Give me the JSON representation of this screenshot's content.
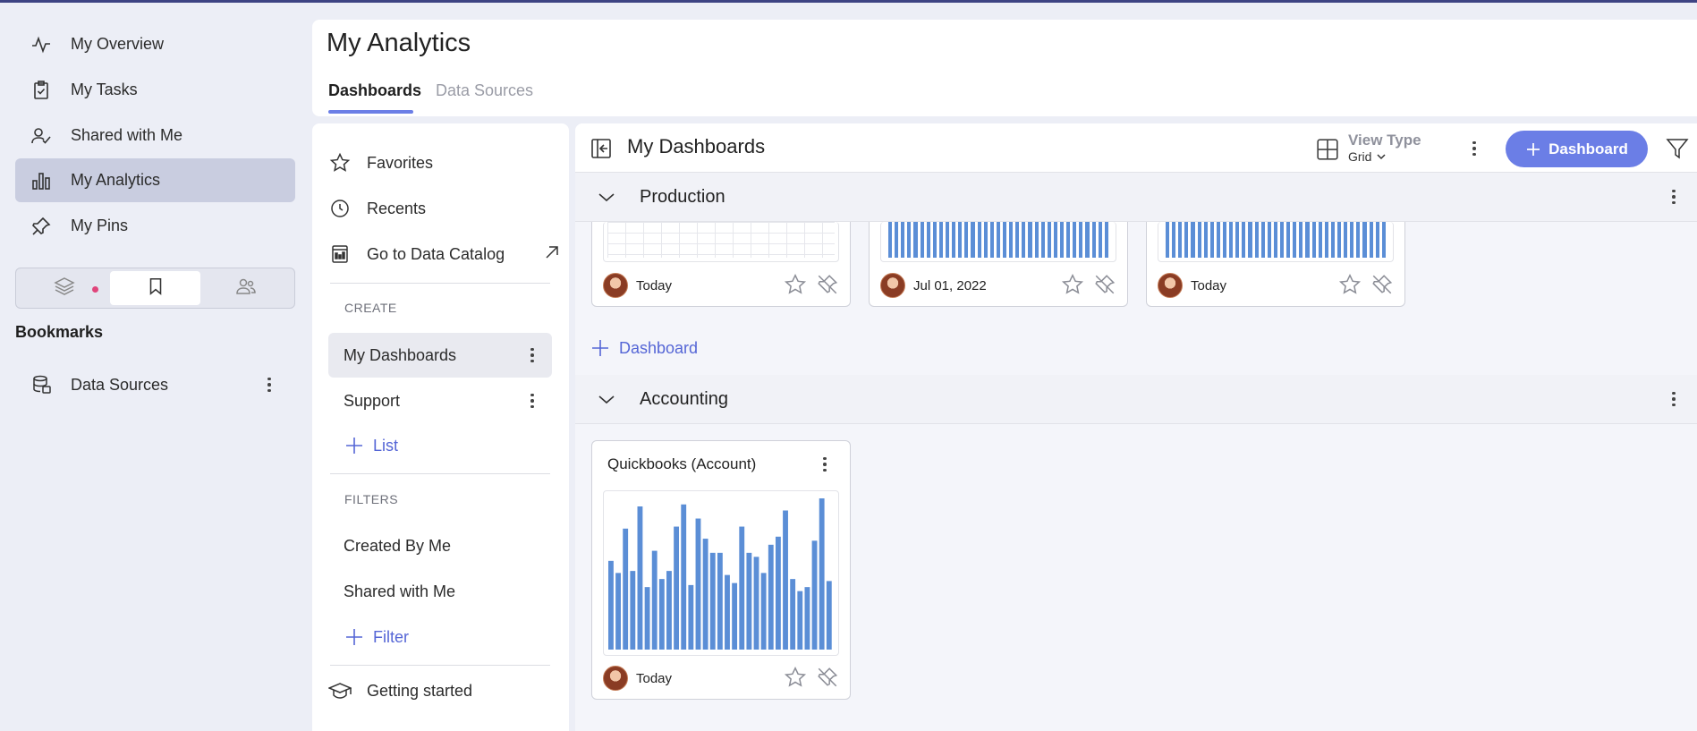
{
  "nav": {
    "items": [
      {
        "label": "My Overview",
        "icon": "activity-icon"
      },
      {
        "label": "My Tasks",
        "icon": "clipboard-check-icon"
      },
      {
        "label": "Shared with Me",
        "icon": "user-check-icon"
      },
      {
        "label": "My Analytics",
        "icon": "bar-chart-icon",
        "active": true
      },
      {
        "label": "My Pins",
        "icon": "pin-icon"
      }
    ],
    "segments": [
      "layers-icon",
      "bookmark-icon",
      "users-icon"
    ],
    "bookmarks_title": "Bookmarks",
    "bookmark_items": [
      {
        "label": "Data Sources",
        "icon": "database-icon"
      }
    ]
  },
  "header": {
    "title": "My Analytics",
    "tabs": [
      {
        "label": "Dashboards",
        "active": true
      },
      {
        "label": "Data Sources",
        "active": false
      }
    ]
  },
  "middle": {
    "favorites": "Favorites",
    "recents": "Recents",
    "catalog": "Go to Data Catalog",
    "create_section": "CREATE",
    "lists": [
      "My Dashboards",
      "Support"
    ],
    "add_list": "List",
    "filters_section": "FILTERS",
    "filters": [
      "Created By Me",
      "Shared with Me"
    ],
    "add_filter": "Filter",
    "getting_started": "Getting started"
  },
  "main": {
    "title": "My Dashboards",
    "view_type_label": "View Type",
    "view_type_value": "Grid",
    "add_dashboard": "Dashboard",
    "groups": [
      {
        "name": "Production",
        "cards": [
          {
            "date": "Today"
          },
          {
            "date": "Jul 01, 2022"
          },
          {
            "date": "Today"
          }
        ],
        "add_label": "Dashboard"
      },
      {
        "name": "Accounting",
        "cards": [
          {
            "title": "Quickbooks (Account)",
            "date": "Today"
          }
        ]
      }
    ]
  },
  "colors": {
    "accent": "#6b7ee6",
    "bar": "#5b8ed6",
    "nav_active": "#c9cde0",
    "badge_dot": "#e0457b"
  },
  "chart_data": {
    "type": "bar",
    "title": "",
    "values": [
      44,
      38,
      60,
      39,
      71,
      31,
      49,
      35,
      39,
      61,
      72,
      32,
      65,
      55,
      48,
      48,
      37,
      33,
      61,
      48,
      46,
      38,
      52,
      56,
      69,
      35,
      29,
      31,
      54,
      75,
      34
    ]
  }
}
